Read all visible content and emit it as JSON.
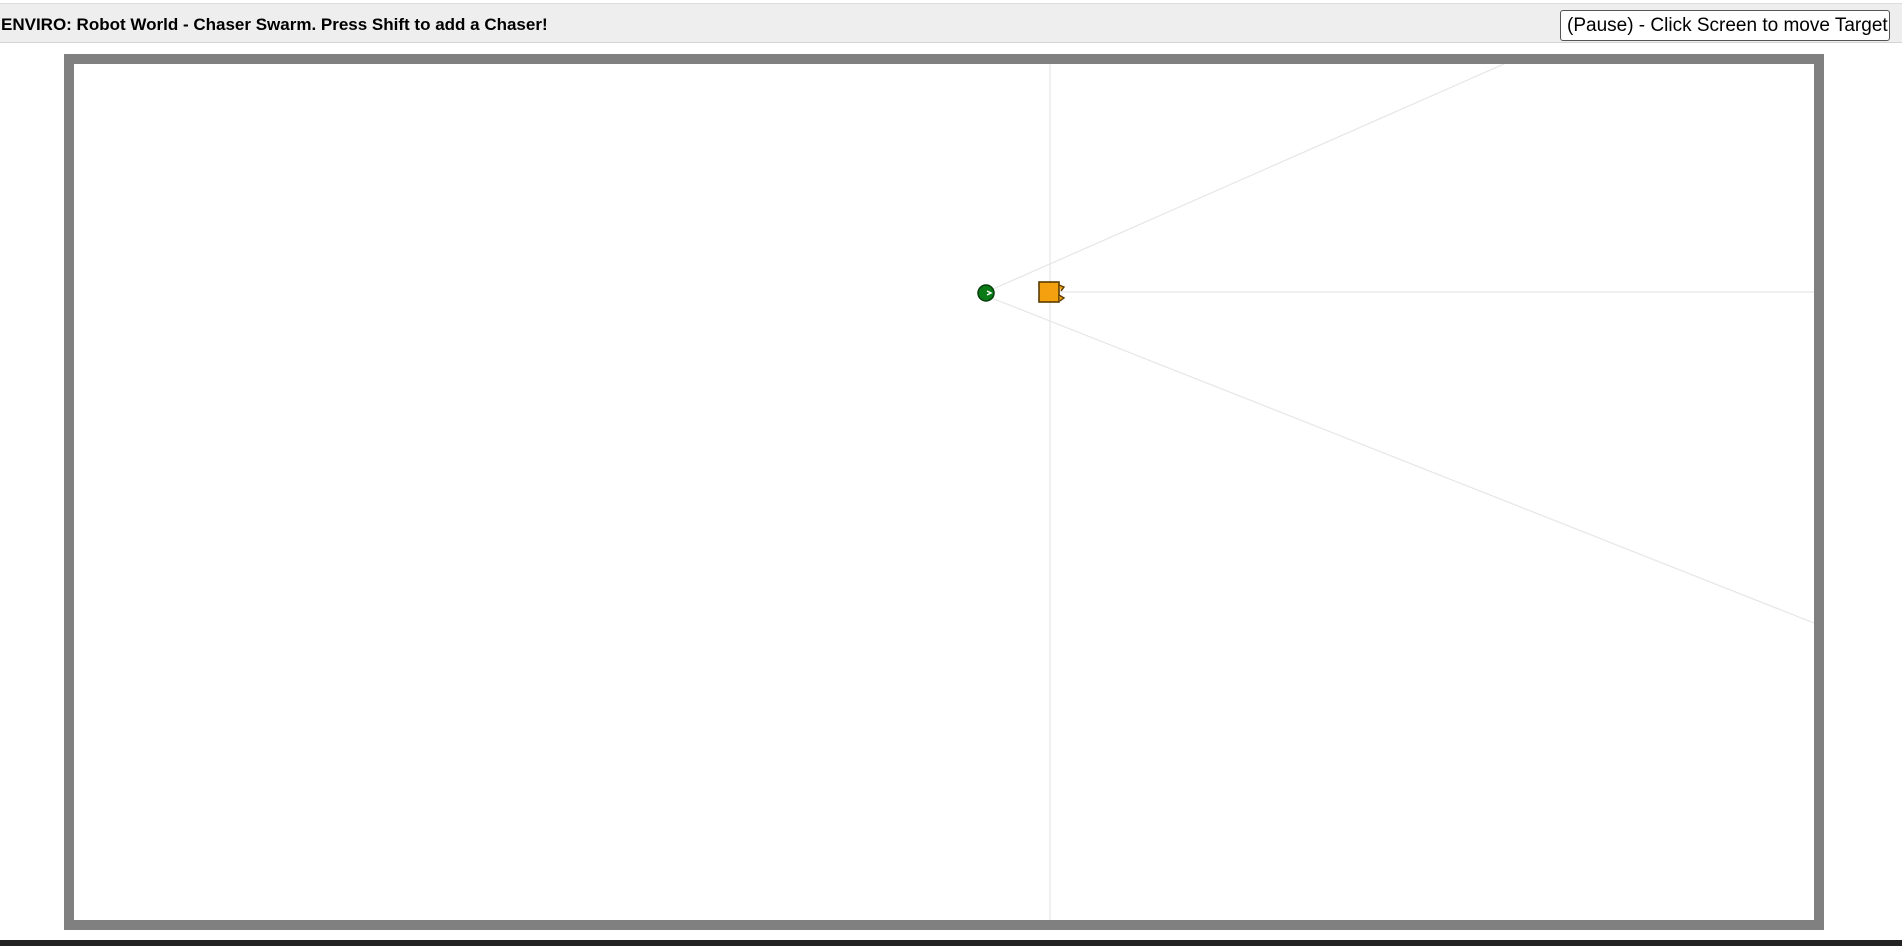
{
  "header": {
    "title": "ENVIRO: Robot World - Chaser Swarm. Press Shift to add a Chaser!",
    "pause_button_label": "(Pause) - Click Screen to move Target"
  },
  "arena": {
    "wall_color": "#808080",
    "background_color": "#ffffff",
    "sensor_line_color": "#e6e6e6"
  },
  "entities": {
    "target": {
      "kind": "target",
      "color": "#0a7a16"
    },
    "chaser": {
      "kind": "chaser",
      "color": "#f5a00e",
      "heading": "west"
    }
  }
}
